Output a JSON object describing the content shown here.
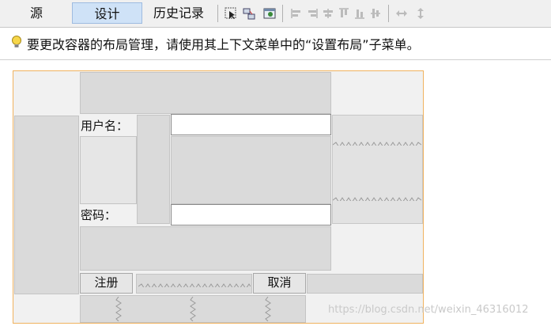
{
  "tabs": [
    {
      "label": "源"
    },
    {
      "label": "设计"
    },
    {
      "label": "历史记录"
    }
  ],
  "toolbar_icons": [
    "selection-mode-icon",
    "connection-mode-icon",
    "preview-icon",
    "align-left-icon",
    "align-right-icon",
    "center-horizontal-icon",
    "align-top-icon",
    "align-bottom-icon",
    "center-vertical-icon",
    "change-horizontal-resizability-icon",
    "change-vertical-resizability-icon"
  ],
  "hint": {
    "icon": "lightbulb-icon",
    "text": "要更改容器的布局管理，请使用其上下文菜单中的“设置布局”子菜单。"
  },
  "form": {
    "username_label": "用户名：",
    "password_label": "密码：",
    "username_value": "",
    "password_value": "",
    "register_button": "注册",
    "cancel_button": "取消"
  },
  "watermark": "https://blog.csdn.net/weixin_46316012",
  "colors": {
    "selected_tab": "#cfe2f7",
    "canvas_border": "#f0b25e",
    "grid_cell": "#dadada"
  }
}
